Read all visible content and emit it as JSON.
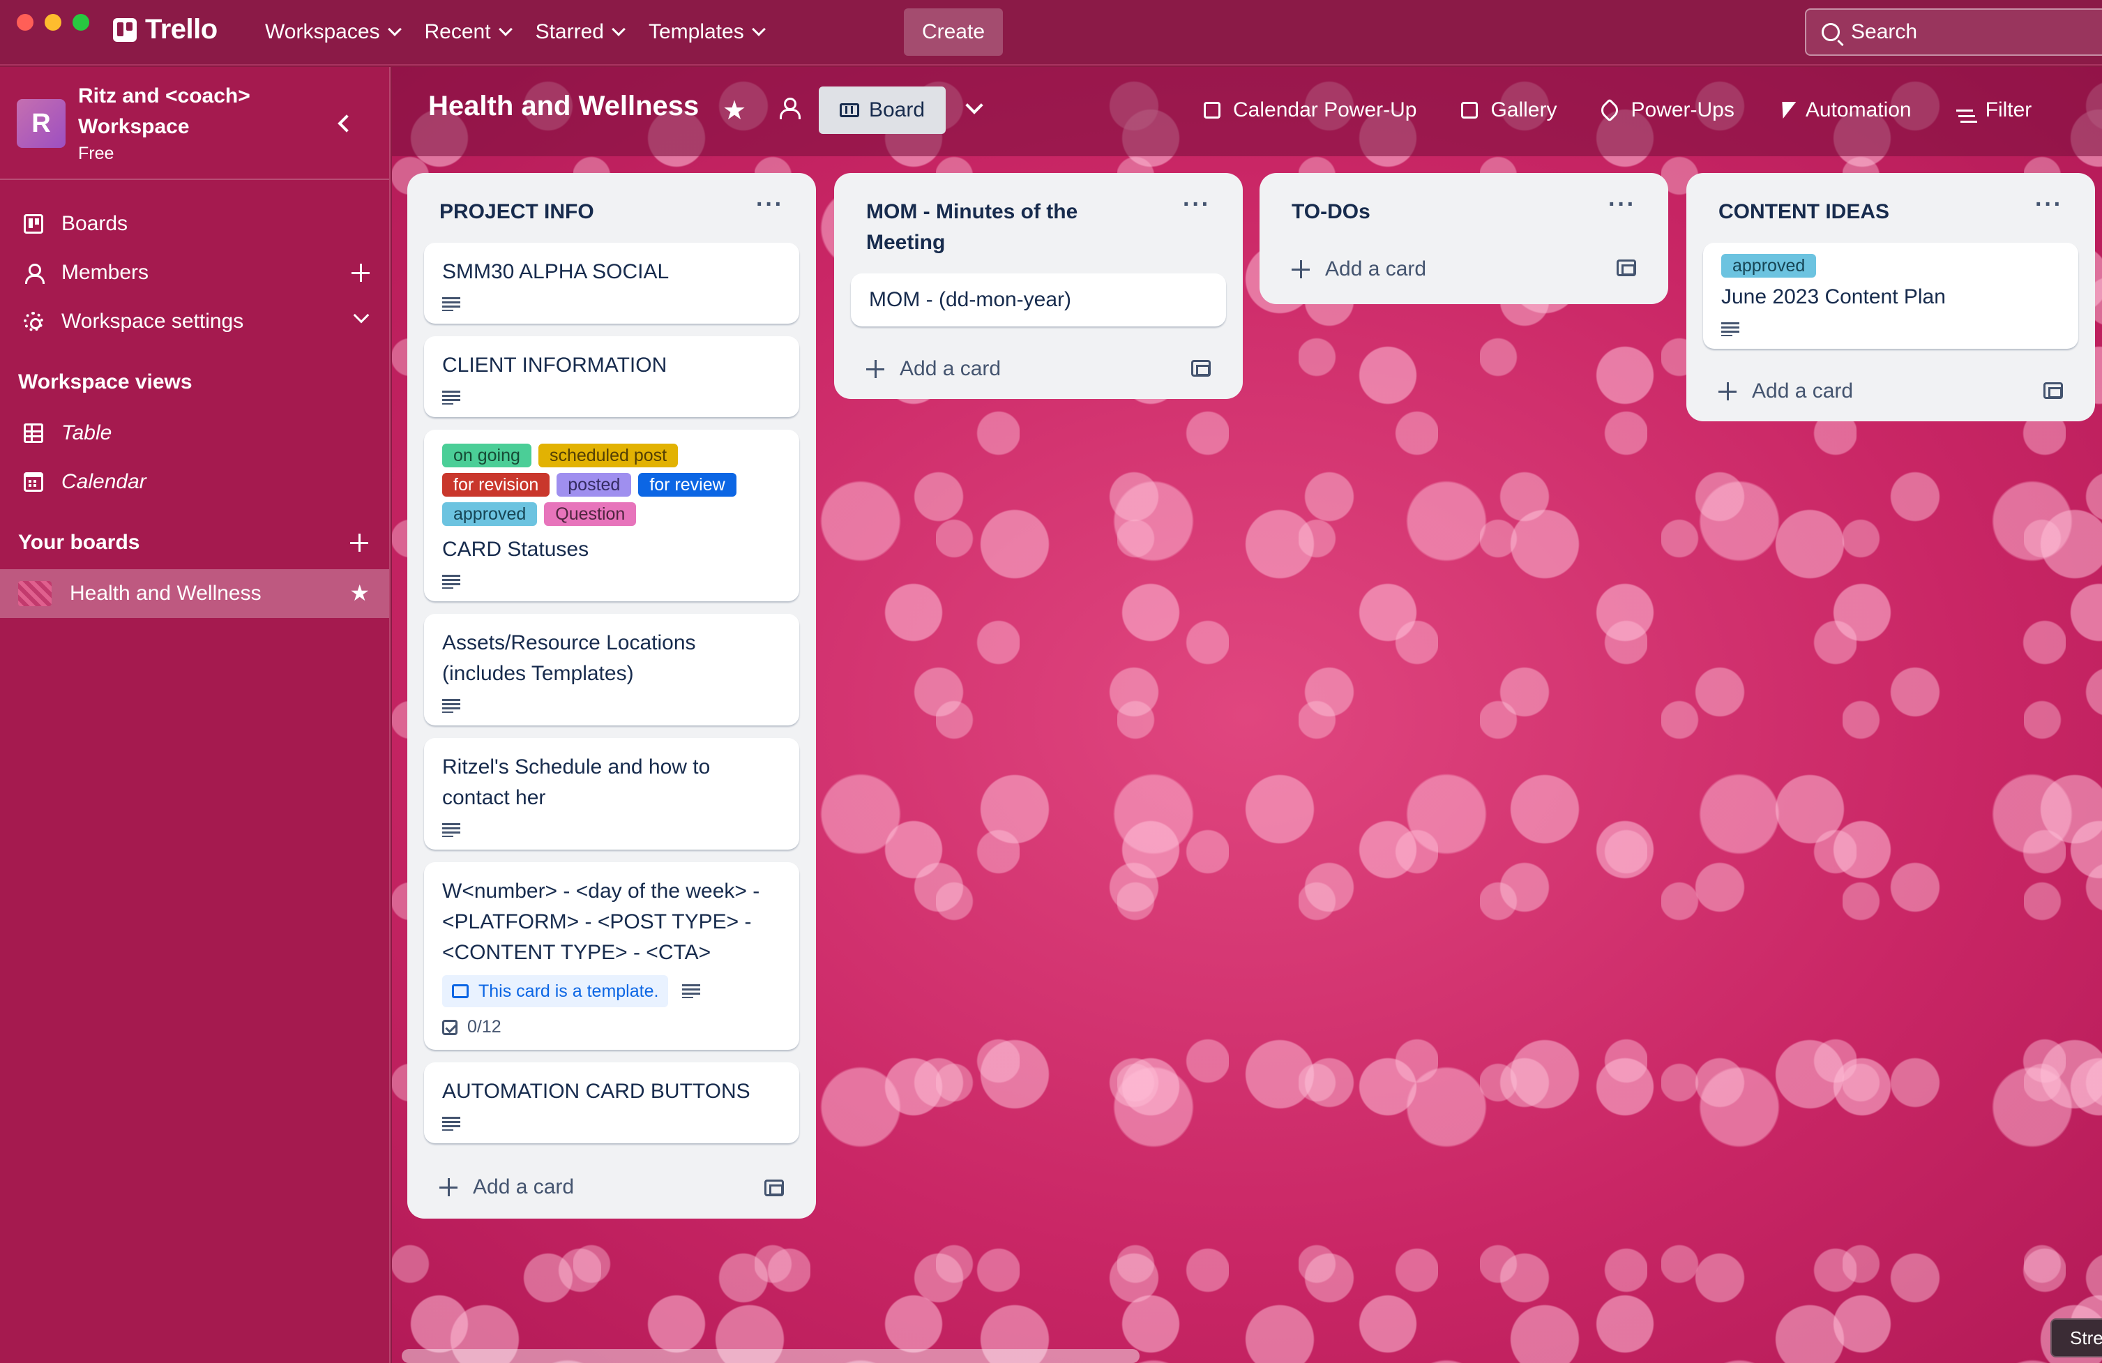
{
  "window": {
    "controls": [
      "#ff5f57",
      "#febc2e",
      "#28c840"
    ]
  },
  "topbar": {
    "logo_text": "Trello",
    "nav": [
      {
        "label": "Workspaces"
      },
      {
        "label": "Recent"
      },
      {
        "label": "Starred"
      },
      {
        "label": "Templates"
      }
    ],
    "create_label": "Create",
    "search_placeholder": "Search"
  },
  "sidebar": {
    "workspace_initial": "R",
    "workspace_name": "Ritz and <coach> Workspace",
    "workspace_plan": "Free",
    "items": [
      {
        "label": "Boards",
        "icon": "board-icon"
      },
      {
        "label": "Members",
        "icon": "member-icon"
      },
      {
        "label": "Workspace settings",
        "icon": "gear-icon"
      }
    ],
    "views_heading": "Workspace views",
    "views": [
      {
        "label": "Table",
        "icon": "table-icon"
      },
      {
        "label": "Calendar",
        "icon": "calendar-icon"
      }
    ],
    "boards_heading": "Your boards",
    "boards": [
      {
        "label": "Health and Wellness",
        "starred": true
      }
    ]
  },
  "board": {
    "title": "Health and Wellness",
    "view_label": "Board",
    "header_buttons": [
      {
        "label": "Calendar Power-Up",
        "icon": "calendar-icon"
      },
      {
        "label": "Gallery",
        "icon": "gallery-icon"
      },
      {
        "label": "Power-Ups",
        "icon": "rocket-icon"
      },
      {
        "label": "Automation",
        "icon": "bolt-icon"
      },
      {
        "label": "Filter",
        "icon": "filter-icon"
      }
    ],
    "add_card_label": "Add a card",
    "lists": [
      {
        "title": "PROJECT INFO",
        "cards": [
          {
            "title": "SMM30 ALPHA SOCIAL"
          },
          {
            "title": "CLIENT INFORMATION"
          },
          {
            "title": "CARD Statuses",
            "labels": [
              {
                "text": "on going",
                "bg": "#4bce97",
                "fg": "#164b35"
              },
              {
                "text": "scheduled post",
                "bg": "#e2b203",
                "fg": "#533f04"
              },
              {
                "text": "for revision",
                "bg": "#c9372c",
                "fg": "#ffffff"
              },
              {
                "text": "posted",
                "bg": "#9f8fef",
                "fg": "#352c63"
              },
              {
                "text": "for review",
                "bg": "#0c66e4",
                "fg": "#ffffff"
              },
              {
                "text": "approved",
                "bg": "#6cc3e0",
                "fg": "#164555"
              },
              {
                "text": "Question",
                "bg": "#e774bb",
                "fg": "#50253f"
              }
            ]
          },
          {
            "title": "Assets/Resource Locations (includes Templates)"
          },
          {
            "title": "Ritzel's Schedule and how to contact her"
          },
          {
            "title": "W<number> - <day of the week> - <PLATFORM> - <POST TYPE> - <CONTENT TYPE> - <CTA>",
            "template_badge": "This card is a template.",
            "checklist": "0/12"
          },
          {
            "title": "AUTOMATION CARD BUTTONS"
          }
        ]
      },
      {
        "title": "MOM - Minutes of the Meeting",
        "cards": [
          {
            "title": "MOM - (dd-mon-year)"
          }
        ]
      },
      {
        "title": "TO-DOs",
        "cards": []
      },
      {
        "title": "CONTENT IDEAS",
        "cards": [
          {
            "title": "June 2023 Content Plan",
            "labels": [
              {
                "text": "approved",
                "bg": "#6cc3e0",
                "fg": "#164555"
              }
            ]
          }
        ]
      }
    ]
  },
  "corner_button": "Stre"
}
